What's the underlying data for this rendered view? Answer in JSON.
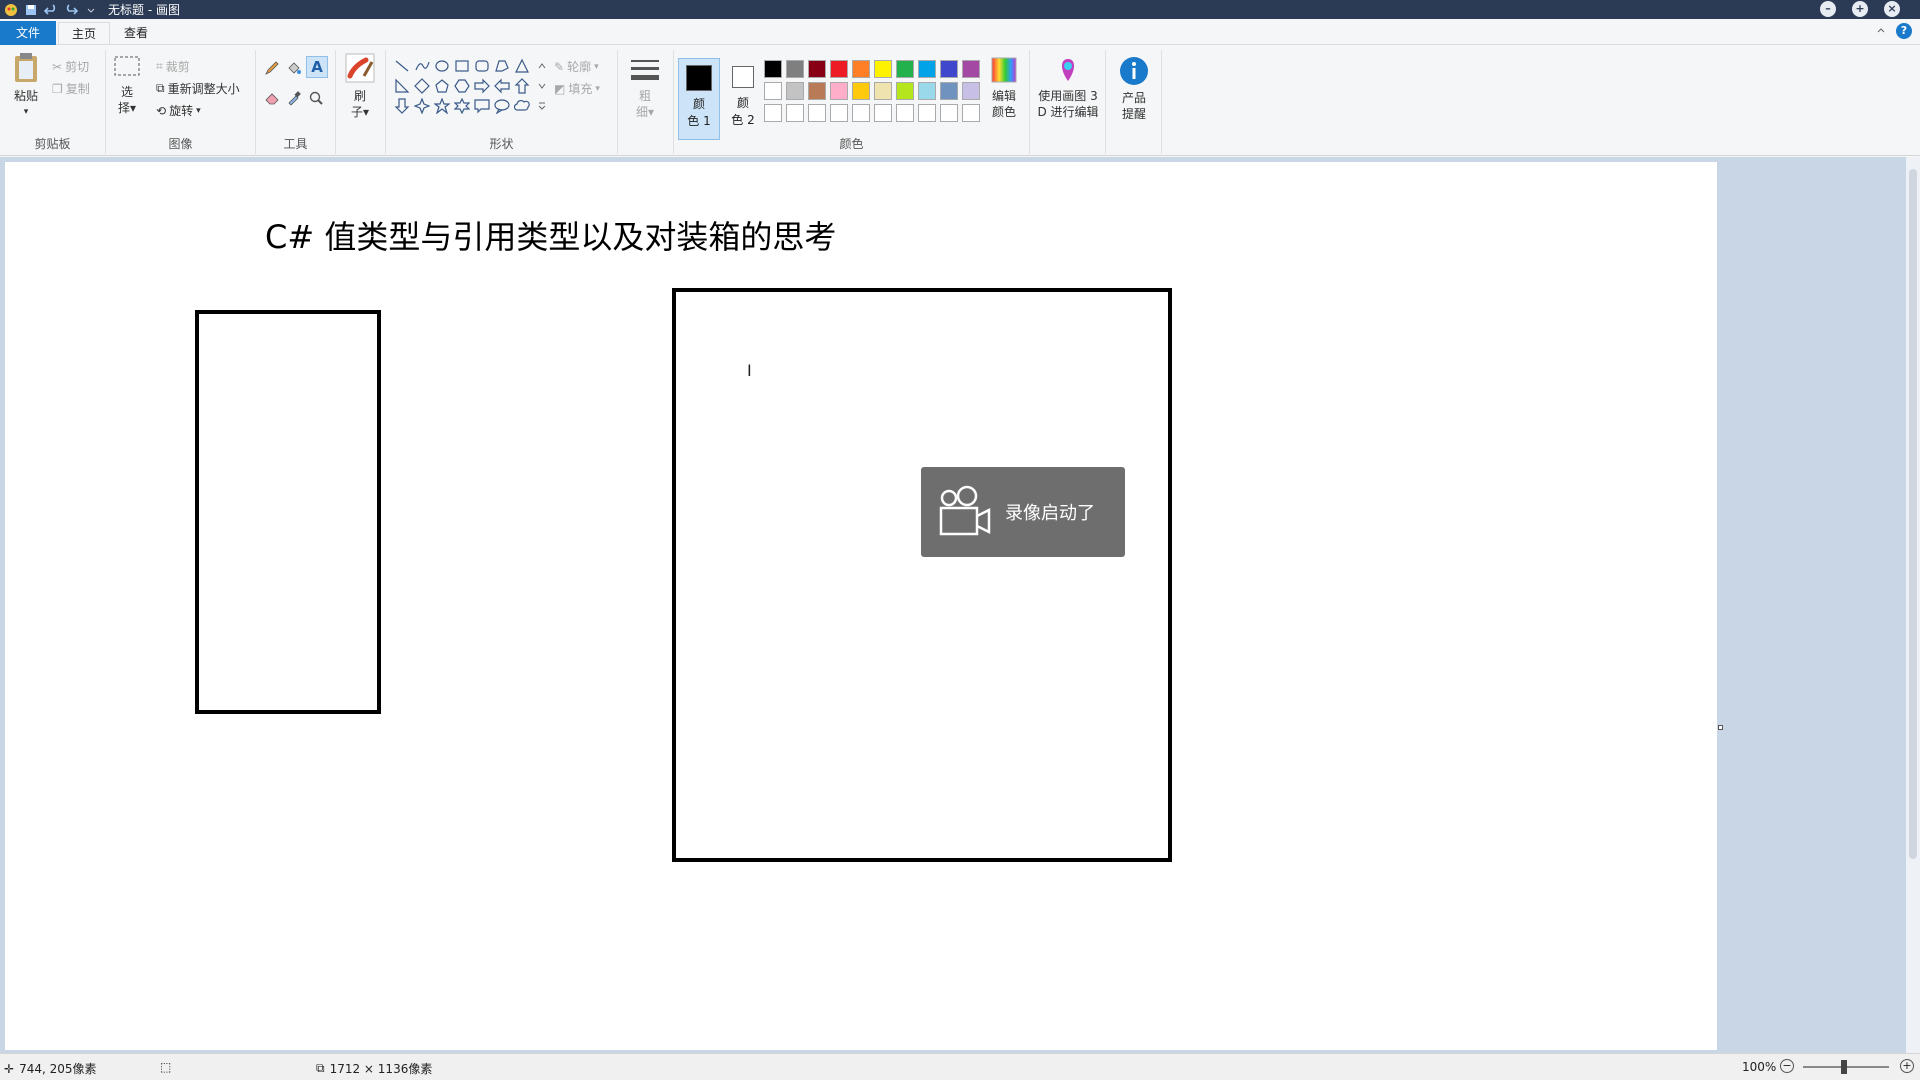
{
  "window": {
    "title": "无标题 - 画图"
  },
  "tabs": {
    "file": "文件",
    "home": "主页",
    "view": "查看"
  },
  "ribbon": {
    "clipboard": {
      "label": "剪贴板",
      "paste": "粘贴",
      "cut": "剪切",
      "copy": "复制"
    },
    "image": {
      "label": "图像",
      "select_top": "选",
      "select_bottom": "择",
      "crop": "裁剪",
      "resize": "重新调整大小",
      "rotate": "旋转"
    },
    "tools": {
      "label": "工具",
      "brush_top": "刷",
      "brush_bottom": "子"
    },
    "shapes": {
      "label": "形状",
      "outline": "轮廓",
      "fill": "填充"
    },
    "size": {
      "top": "粗",
      "bottom": "细"
    },
    "colors": {
      "label": "颜色",
      "color1_top": "颜",
      "color1_bottom": "色 1",
      "color2_top": "颜",
      "color2_bottom": "色 2",
      "edit_top": "编辑",
      "edit_bottom": "颜色",
      "color1_value": "#000000",
      "color2_value": "#ffffff",
      "palette": [
        "#000000",
        "#7f7f7f",
        "#880015",
        "#ed1c24",
        "#ff7f27",
        "#fff200",
        "#22b14c",
        "#00a2e8",
        "#3f48cc",
        "#a349a4",
        "#ffffff",
        "#c3c3c3",
        "#b97a57",
        "#ffaec9",
        "#ffc90e",
        "#efe4b0",
        "#b5e61d",
        "#99d9ea",
        "#7092be",
        "#c8bfe7",
        "#ffffff",
        "#ffffff",
        "#ffffff",
        "#ffffff",
        "#ffffff",
        "#ffffff",
        "#ffffff",
        "#ffffff",
        "#ffffff",
        "#ffffff"
      ]
    },
    "paint3d": {
      "top": "使用画图 3",
      "bottom": "D 进行编辑"
    },
    "product_alert": {
      "top": "产品",
      "bottom": "提醒"
    }
  },
  "canvas": {
    "title": "C# 值类型与引用类型以及对装箱的思考",
    "toast": "录像启动了"
  },
  "status": {
    "position": "744, 205像素",
    "size": "1712 × 1136像素",
    "zoom": "100%"
  }
}
